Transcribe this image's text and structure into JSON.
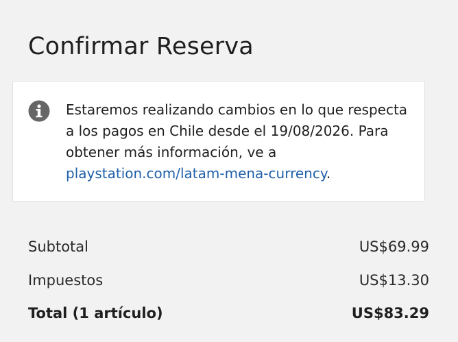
{
  "page": {
    "title": "Confirmar Reserva"
  },
  "notice": {
    "icon": "info-icon",
    "text_before": "Estaremos realizando cambios en lo que respecta a los pagos en Chile desde el 19/08/2026. Para obtener más información, ve a ",
    "link_text": "playstation.com/latam-mena-currency",
    "text_after": "."
  },
  "summary": {
    "subtotal": {
      "label": "Subtotal",
      "value": "US$69.99"
    },
    "taxes": {
      "label": "Impuestos",
      "value": "US$13.30"
    },
    "total": {
      "label": "Total (1 artículo)",
      "value": "US$83.29"
    }
  },
  "colors": {
    "background": "#f2f2f2",
    "card": "#ffffff",
    "link": "#1f5fa8",
    "icon": "#666666",
    "text": "#1f1f1f"
  }
}
